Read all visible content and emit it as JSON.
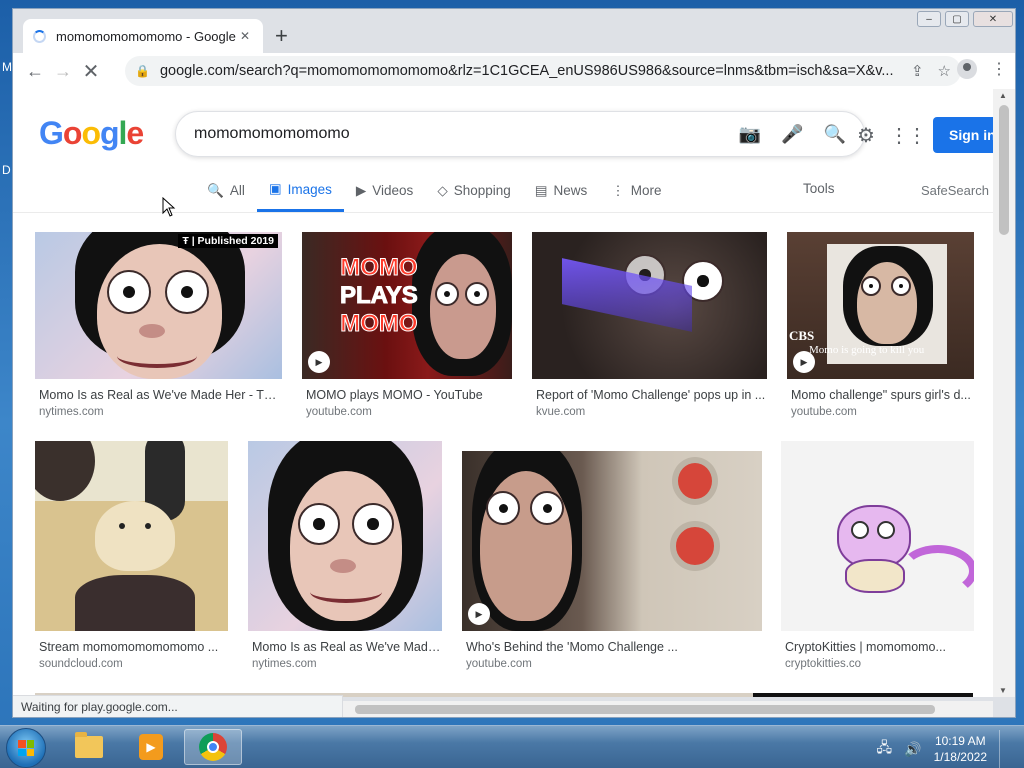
{
  "desktop": {
    "left_letters": [
      "M",
      "D"
    ]
  },
  "browser": {
    "tab_title": "momomomomomomo - Google",
    "tab_close": "✕",
    "new_tab": "+",
    "url": "google.com/search?q=momomomomomomo&rlz=1C1GCEA_enUS986US986&source=lnms&tbm=isch&sa=X&v...",
    "window_controls": [
      "–",
      "▢",
      "✕"
    ]
  },
  "google": {
    "logo": [
      "G",
      "o",
      "o",
      "g",
      "l",
      "e"
    ],
    "query": "momomomomomomo",
    "sign_in": "Sign in",
    "tabs": [
      {
        "label": "All",
        "icon": "🔍",
        "active": false
      },
      {
        "label": "Images",
        "icon": "▣",
        "active": true
      },
      {
        "label": "Videos",
        "icon": "▶",
        "active": false
      },
      {
        "label": "Shopping",
        "icon": "◇",
        "active": false
      },
      {
        "label": "News",
        "icon": "▤",
        "active": false
      },
      {
        "label": "More",
        "icon": "⋮",
        "active": false
      }
    ],
    "tools": "Tools",
    "safesearch": "SafeSearch o"
  },
  "results": [
    {
      "caption": "Momo Is as Real as We've Made Her - The...",
      "source": "nytimes.com",
      "badge": "Ŧ | Published 2019",
      "video": false
    },
    {
      "caption": "MOMO plays MOMO - YouTube",
      "source": "youtube.com",
      "overlay": [
        "MOMO",
        "PLAYS",
        "MOMO"
      ],
      "video": true
    },
    {
      "caption": "Report of 'Momo Challenge' pops up in ...",
      "source": "kvue.com",
      "video": false
    },
    {
      "caption": "Momo challenge\" spurs girl's d...",
      "source": "youtube.com",
      "overlay_small": "Momo is going to kill you",
      "overlay_logo": "CBS",
      "video": true
    },
    {
      "caption": "Stream momomomomomomo ...",
      "source": "soundcloud.com",
      "video": false
    },
    {
      "caption": "Momo Is as Real as We've Made...",
      "source": "nytimes.com",
      "video": false
    },
    {
      "caption": "Who's Behind the 'Momo Challenge ...",
      "source": "youtube.com",
      "video": true
    },
    {
      "caption": "CryptoKitties | momomomo...",
      "source": "cryptokitties.co",
      "video": false
    }
  ],
  "status_text": "Waiting for play.google.com...",
  "taskbar": {
    "time": "10:19 AM",
    "date": "1/18/2022"
  }
}
